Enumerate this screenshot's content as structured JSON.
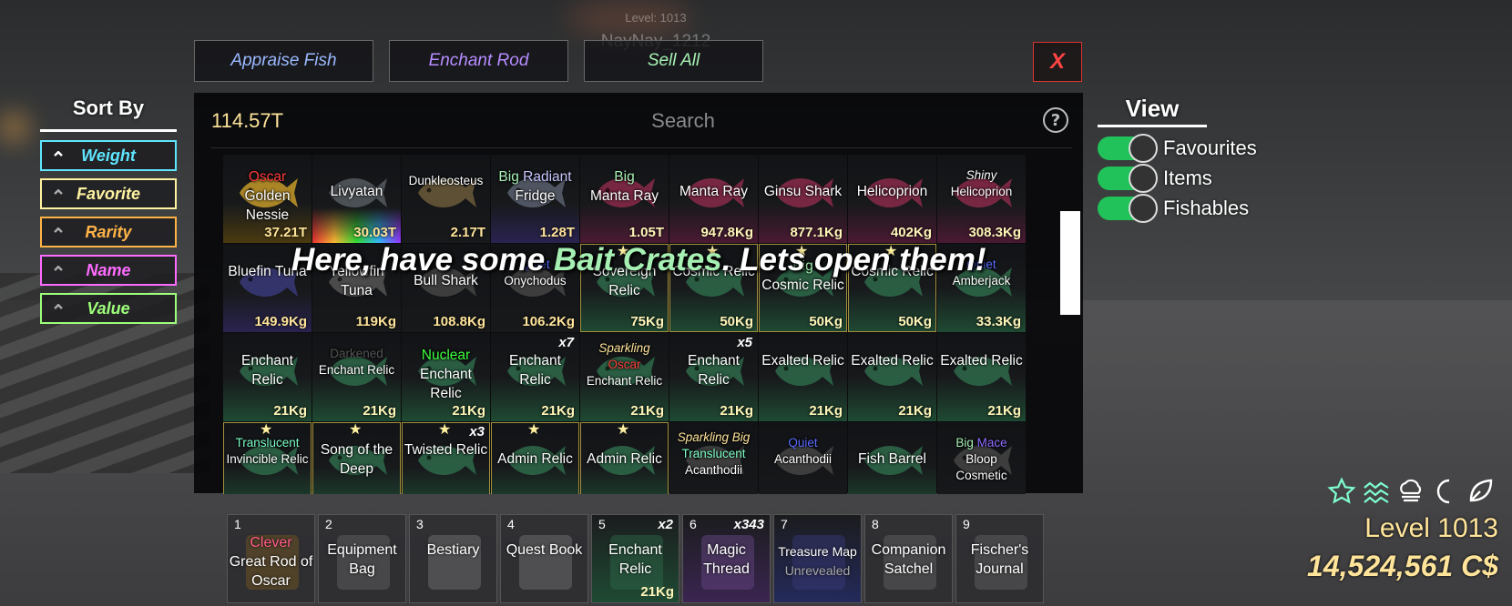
{
  "background": {
    "level_text": "Level: 1013",
    "player_name": "NayNay_1212"
  },
  "top_buttons": [
    {
      "label": "Appraise Fish",
      "color": "#9ab9ff"
    },
    {
      "label": "Enchant Rod",
      "color": "#b58cff"
    },
    {
      "label": "Sell All",
      "color": "#a7f0b4"
    }
  ],
  "close_label": "X",
  "inventory": {
    "money": "114.57T",
    "search_placeholder": "Search",
    "help_icon": "?"
  },
  "banner": {
    "before": "Here, have some ",
    "highlight": "Bait Crates",
    "after": ". Lets open them!"
  },
  "items": [
    {
      "mods": [
        {
          "t": "Oscar",
          "c": "#ff3b3b"
        }
      ],
      "name": "Golden Nessie",
      "weight": "37.21T",
      "fish": "#c59a2a",
      "stripe": "golden"
    },
    {
      "mods": [],
      "name": "Livyatan",
      "weight": "30.03T",
      "fish": "#555a60",
      "stripe": "rainbow"
    },
    {
      "mods": [],
      "name": "Dunkleosteus",
      "weight": "2.17T",
      "fish": "#6b5a3a",
      "small": true
    },
    {
      "mods": [
        {
          "t": "Big ",
          "c": "#a7f0b4"
        },
        {
          "t": "Radiant",
          "c": "#c7c7ff"
        }
      ],
      "inline": true,
      "name": "Fridge",
      "weight": "1.28T",
      "fish": "#5a6070",
      "stripe": "purple"
    },
    {
      "mods": [
        {
          "t": "Big ",
          "c": "#a7f0b4"
        }
      ],
      "inline": true,
      "name": "Manta Ray",
      "weight": "1.05T",
      "fish": "#8a2a4a",
      "stripe": "pink"
    },
    {
      "mods": [],
      "name": "Manta Ray",
      "weight": "947.8Kg",
      "fish": "#8a2a4a",
      "stripe": "pink"
    },
    {
      "mods": [],
      "name": "Ginsu Shark",
      "weight": "877.1Kg",
      "fish": "#8a2a4a",
      "stripe": "pink"
    },
    {
      "mods": [],
      "name": "Helicoprion",
      "weight": "402Kg",
      "fish": "#8a2a4a",
      "stripe": "pink"
    },
    {
      "mods": [
        {
          "t": "Shiny",
          "c": "#ffffff",
          "i": true
        }
      ],
      "name": "Helicoprion",
      "weight": "308.3Kg",
      "fish": "#8a2a4a",
      "stripe": "pink",
      "small": true
    },
    {
      "mods": [],
      "name": "Bluefin Tuna",
      "weight": "149.9Kg",
      "fish": "#3a3a7a",
      "stripe": "purple"
    },
    {
      "mods": [],
      "name": "Yellowfin Tuna",
      "weight": "119Kg",
      "fish": "#555",
      "stripe": "none"
    },
    {
      "mods": [],
      "name": "Bull Shark",
      "weight": "108.8Kg",
      "fish": "#444",
      "stripe": "none"
    },
    {
      "mods": [
        {
          "t": "Quiet",
          "c": "#5a6cff"
        }
      ],
      "name": "Onychodus",
      "weight": "106.2Kg",
      "fish": "#444",
      "stripe": "none",
      "small": true
    },
    {
      "mods": [],
      "name": "Sovereign Relic",
      "weight": "75Kg",
      "fish": "#2e6a4a",
      "stripe": "green",
      "star": true,
      "gold": true
    },
    {
      "mods": [],
      "name": "Cosmic Relic",
      "weight": "50Kg",
      "fish": "#2e6a4a",
      "stripe": "green",
      "star": true,
      "gold": true
    },
    {
      "mods": [
        {
          "t": "Big",
          "c": "#a7f0b4"
        }
      ],
      "name": "Cosmic Relic",
      "weight": "50Kg",
      "fish": "#2e6a4a",
      "stripe": "green",
      "star": true,
      "gold": true
    },
    {
      "mods": [],
      "name": "Cosmic Relic",
      "weight": "50Kg",
      "fish": "#2e6a4a",
      "stripe": "green",
      "star": true,
      "gold": true
    },
    {
      "mods": [
        {
          "t": "Quiet",
          "c": "#5a6cff"
        }
      ],
      "name": "Amberjack",
      "weight": "33.3Kg",
      "fish": "#2e6a4a",
      "stripe": "green",
      "small": true
    },
    {
      "mods": [],
      "name": "Enchant Relic",
      "weight": "21Kg",
      "fish": "#2e6a4a",
      "stripe": "green"
    },
    {
      "mods": [
        {
          "t": "Darkened",
          "c": "#555555"
        }
      ],
      "name": "Enchant Relic",
      "weight": "21Kg",
      "fish": "#2e6a4a",
      "stripe": "green",
      "small": true
    },
    {
      "mods": [
        {
          "t": "Nuclear",
          "c": "#3dff3d"
        }
      ],
      "name": "Enchant Relic",
      "weight": "21Kg",
      "fish": "#2e6a4a",
      "stripe": "green"
    },
    {
      "mods": [],
      "name": "Enchant Relic",
      "weight": "21Kg",
      "qty": "x7",
      "fish": "#2e6a4a",
      "stripe": "green"
    },
    {
      "mods": [
        {
          "t": "Sparkling",
          "c": "#ffe49a",
          "i": true
        },
        {
          "t": "Oscar",
          "c": "#ff3b3b"
        }
      ],
      "name": "Enchant Relic",
      "weight": "21Kg",
      "fish": "#2e6a4a",
      "stripe": "green",
      "small": true
    },
    {
      "mods": [],
      "name": "Enchant Relic",
      "weight": "21Kg",
      "qty": "x5",
      "fish": "#2e6a4a",
      "stripe": "green"
    },
    {
      "mods": [],
      "name": "Exalted Relic",
      "weight": "21Kg",
      "fish": "#2e6a4a",
      "stripe": "green"
    },
    {
      "mods": [],
      "name": "Exalted Relic",
      "weight": "21Kg",
      "fish": "#2e6a4a",
      "stripe": "green"
    },
    {
      "mods": [],
      "name": "Exalted Relic",
      "weight": "21Kg",
      "fish": "#2e6a4a",
      "stripe": "green"
    },
    {
      "mods": [
        {
          "t": "Translucent",
          "c": "#7dffc7"
        }
      ],
      "name": "Invincible Relic",
      "weight": "",
      "fish": "#2e6a4a",
      "stripe": "green",
      "star": true,
      "gold": true,
      "small": true
    },
    {
      "mods": [],
      "name": "Song of the Deep",
      "weight": "",
      "fish": "#2e6a4a",
      "stripe": "green",
      "star": true,
      "gold": true
    },
    {
      "mods": [],
      "name": "Twisted Relic",
      "weight": "",
      "qty": "x3",
      "fish": "#2e6a4a",
      "stripe": "green",
      "star": true,
      "gold": true
    },
    {
      "mods": [],
      "name": "Admin Relic",
      "weight": "",
      "fish": "#2e6a4a",
      "stripe": "green",
      "star": true,
      "gold": true
    },
    {
      "mods": [],
      "name": "Admin Relic",
      "weight": "",
      "fish": "#2e6a4a",
      "stripe": "green",
      "star": true,
      "gold": true
    },
    {
      "mods": [
        {
          "t": "Sparkling Big",
          "c": "#ffe49a",
          "i": true
        },
        {
          "t": "Translucent",
          "c": "#7dffc7"
        }
      ],
      "name": "Acanthodii",
      "weight": "",
      "fish": "#444",
      "stripe": "none",
      "small": true
    },
    {
      "mods": [
        {
          "t": "Quiet",
          "c": "#5a6cff"
        }
      ],
      "name": "Acanthodii",
      "weight": "",
      "fish": "#444",
      "stripe": "none",
      "small": true
    },
    {
      "mods": [],
      "name": "Fish Barrel",
      "weight": "",
      "fish": "#2e6a4a",
      "stripe": "green"
    },
    {
      "mods": [
        {
          "t": "Big ",
          "c": "#a7f0b4"
        },
        {
          "t": "Mace",
          "c": "#8f6bff"
        }
      ],
      "inline": true,
      "name": "Bloop Cosmetic",
      "weight": "",
      "fish": "#444",
      "stripe": "none",
      "small": true
    }
  ],
  "sort": {
    "title": "Sort By",
    "options": [
      {
        "label": "Weight",
        "color": "#5fe5ff",
        "active": true
      },
      {
        "label": "Favorite",
        "color": "#fff2a0"
      },
      {
        "label": "Rarity",
        "color": "#ffb347"
      },
      {
        "label": "Name",
        "color": "#ff6bff"
      },
      {
        "label": "Value",
        "color": "#9dff7a"
      }
    ]
  },
  "view": {
    "title": "View",
    "toggles": [
      {
        "label": "Favourites",
        "on": true
      },
      {
        "label": "Items",
        "on": true
      },
      {
        "label": "Fishables",
        "on": true
      }
    ]
  },
  "hotbar": [
    {
      "num": "1",
      "mods": [
        {
          "t": "Clever",
          "c": "#ff5b8a"
        }
      ],
      "name": "Great Rod of Oscar",
      "icon": "rod-icon"
    },
    {
      "num": "2",
      "name": "Equipment Bag",
      "icon": "bag-icon"
    },
    {
      "num": "3",
      "name": "Bestiary",
      "icon": "book-icon"
    },
    {
      "num": "4",
      "name": "Quest Book",
      "icon": "book-icon"
    },
    {
      "num": "5",
      "name": "Enchant Relic",
      "qty": "x2",
      "weight": "21Kg",
      "icon": "relic-icon"
    },
    {
      "num": "6",
      "name": "Magic Thread",
      "qty": "x343",
      "icon": "thread-icon"
    },
    {
      "num": "7",
      "name": "Treasure Map",
      "sub": "Unrevealed",
      "icon": "map-icon"
    },
    {
      "num": "8",
      "name": "Companion Satchel",
      "icon": "satchel-icon"
    },
    {
      "num": "9",
      "name": "Fischer's Journal",
      "icon": "journal-icon"
    }
  ],
  "status_icons": [
    "star-icon",
    "wind-icon",
    "cloud-icon",
    "moon-icon",
    "leaf-icon"
  ],
  "player": {
    "level": "Level 1013",
    "currency": "14,524,561 C$"
  }
}
